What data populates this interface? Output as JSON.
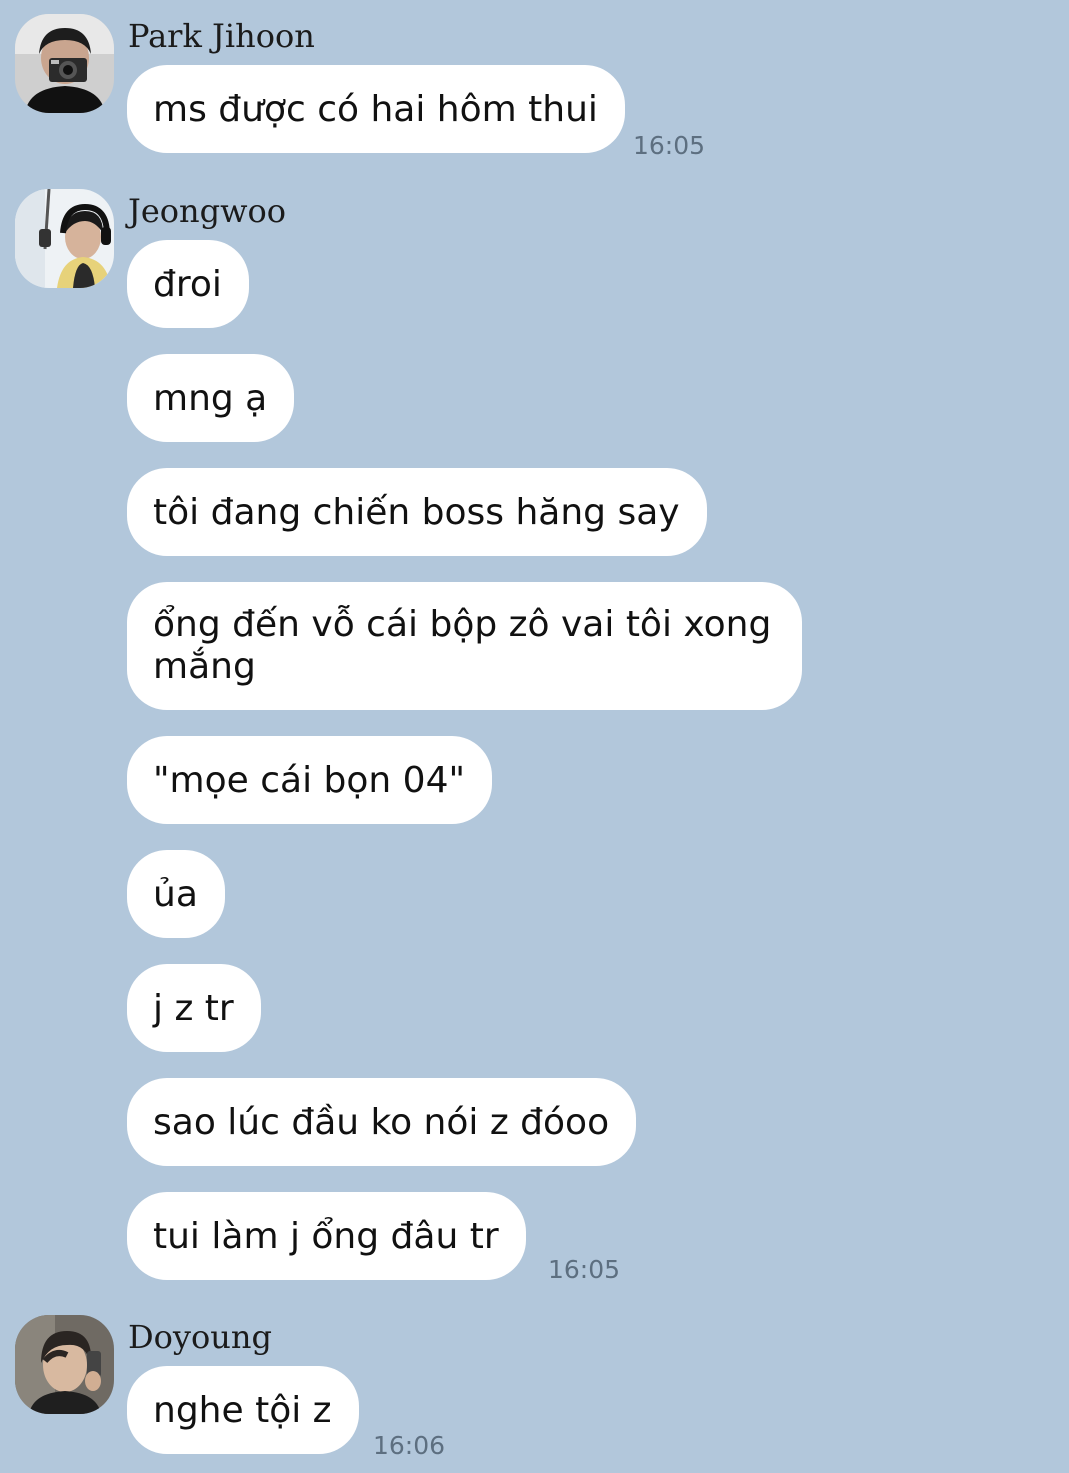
{
  "colors": {
    "background": "#b2c7db",
    "bubble": "#ffffff",
    "text": "#111111",
    "time": "#5d6f80"
  },
  "messages": [
    {
      "sender": "Park Jihoon",
      "avatar": "avatar-photo-icon",
      "bubbles": [
        "ms được có hai hôm thui"
      ],
      "time": "16:05"
    },
    {
      "sender": "Jeongwoo",
      "avatar": "avatar-photo-icon",
      "bubbles": [
        "đroi",
        "mng ạ",
        "tôi đang chiến boss hăng say",
        "ổng đến vỗ cái bộp zô vai tôi xong mắng",
        "\"mọe cái bọn 04\"",
        "ủa",
        "j z tr",
        "sao lúc đầu ko nói z đóoo",
        "tui làm j ổng đâu tr"
      ],
      "time": "16:05"
    },
    {
      "sender": "Doyoung",
      "avatar": "avatar-photo-icon",
      "bubbles": [
        "nghe tội z"
      ],
      "time": "16:06"
    }
  ]
}
